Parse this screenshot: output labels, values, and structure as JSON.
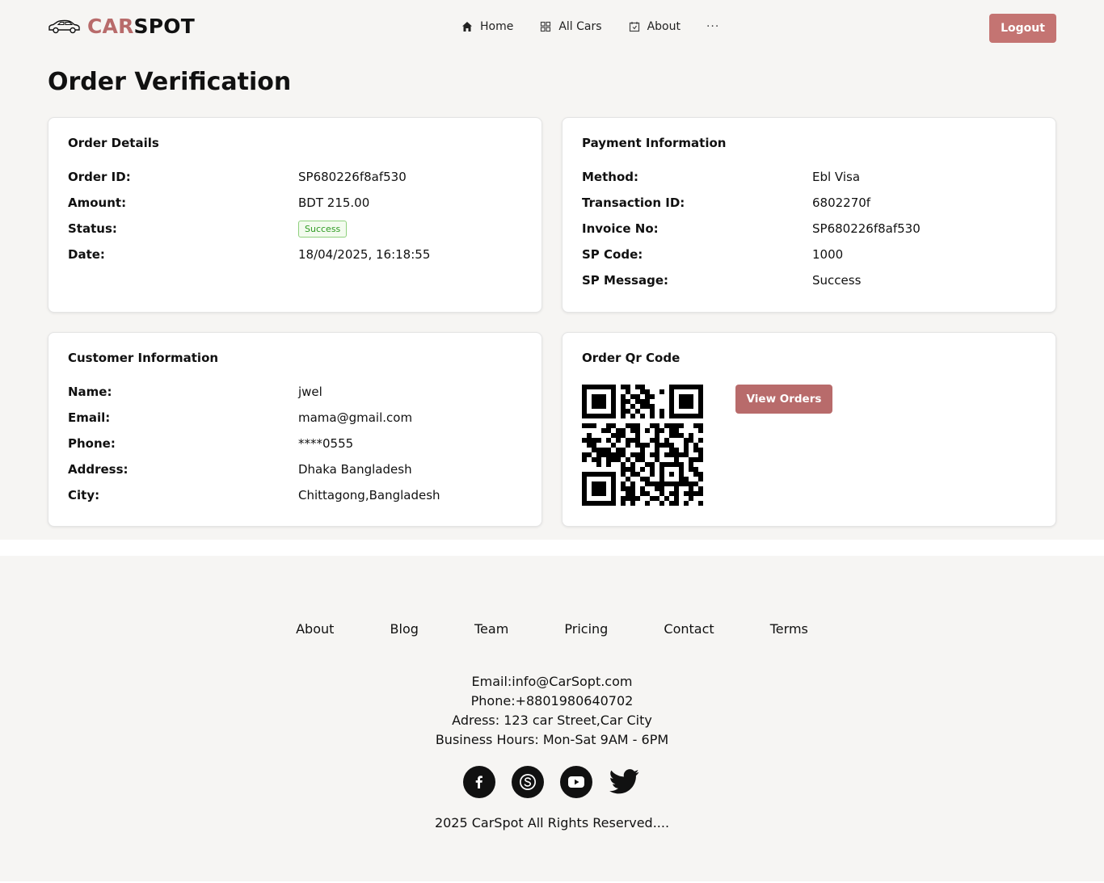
{
  "header": {
    "brand_part1": "CAR",
    "brand_part2": "SPOT",
    "nav": [
      {
        "label": "Home",
        "icon": "home-icon"
      },
      {
        "label": "All Cars",
        "icon": "grid-icon"
      },
      {
        "label": "About",
        "icon": "calendar-icon"
      }
    ],
    "more": "···",
    "logout_label": "Logout"
  },
  "page": {
    "title": "Order Verification"
  },
  "order_details": {
    "title": "Order Details",
    "rows": [
      {
        "label": "Order ID:",
        "value": "SP680226f8af530"
      },
      {
        "label": "Amount:",
        "value": "BDT 215.00"
      },
      {
        "label": "Status:",
        "value": "Success"
      },
      {
        "label": "Date:",
        "value": "18/04/2025, 16:18:55"
      }
    ]
  },
  "payment_info": {
    "title": "Payment Information",
    "rows": [
      {
        "label": "Method:",
        "value": "Ebl Visa"
      },
      {
        "label": "Transaction ID:",
        "value": "6802270f"
      },
      {
        "label": "Invoice No:",
        "value": "SP680226f8af530"
      },
      {
        "label": "SP Code:",
        "value": "1000"
      },
      {
        "label": "SP Message:",
        "value": "Success"
      }
    ]
  },
  "customer_info": {
    "title": "Customer Information",
    "rows": [
      {
        "label": "Name:",
        "value": "jwel"
      },
      {
        "label": "Email:",
        "value": "mama@gmail.com"
      },
      {
        "label": "Phone:",
        "value": "****0555"
      },
      {
        "label": "Address:",
        "value": "Dhaka Bangladesh"
      },
      {
        "label": "City:",
        "value": "Chittagong,Bangladesh"
      }
    ]
  },
  "qr_card": {
    "title": "Order Qr Code",
    "button_label": "View Orders"
  },
  "footer": {
    "links": [
      "About",
      "Blog",
      "Team",
      "Pricing",
      "Contact",
      "Terms"
    ],
    "email": "Email:info@CarSopt.com",
    "phone": "Phone:+8801980640702",
    "address": "Adress: 123 car Street,Car City",
    "hours": "Business Hours: Mon-Sat 9AM - 6PM",
    "social": [
      "facebook-icon",
      "skype-icon",
      "youtube-icon",
      "twitter-icon"
    ],
    "copyright": "2025 CarSpot All Rights Reserved...."
  },
  "colors": {
    "accent": "#c47472",
    "background": "#f6f5f3",
    "success": "#2e9b22"
  }
}
